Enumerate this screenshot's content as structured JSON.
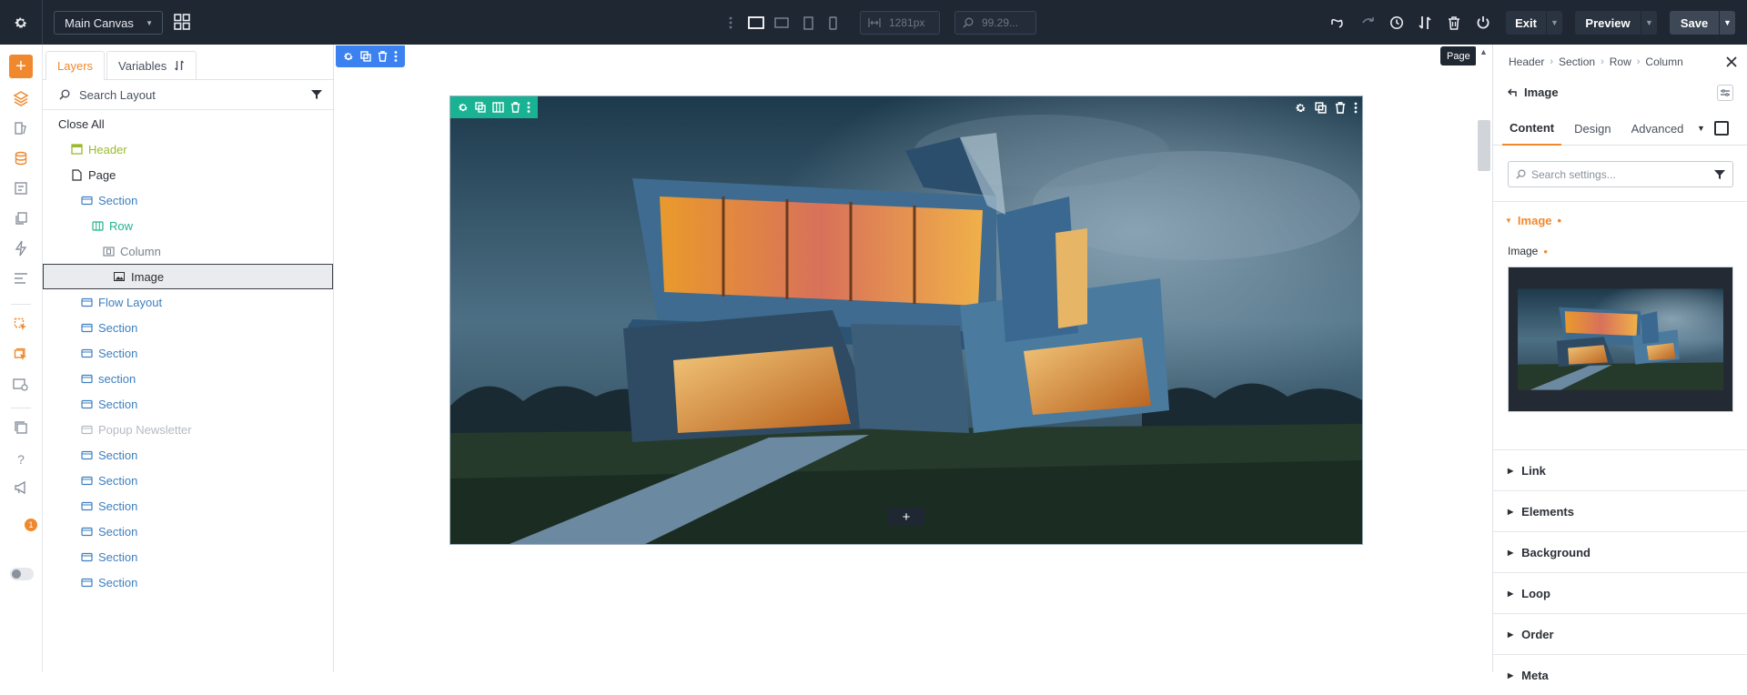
{
  "topbar": {
    "canvas_name": "Main Canvas",
    "width_value": "1281px",
    "zoom_value": "99.29...",
    "exit_label": "Exit",
    "preview_label": "Preview",
    "save_label": "Save"
  },
  "layers": {
    "tabs": [
      "Layers",
      "Variables"
    ],
    "search_placeholder": "Search Layout",
    "close_all": "Close All",
    "tree": [
      {
        "label": "Header",
        "icon": "header-icon",
        "color": "green"
      },
      {
        "label": "Page",
        "icon": "page-icon",
        "color": "dark"
      },
      {
        "label": "Section",
        "icon": "section-icon",
        "color": "blue"
      },
      {
        "label": "Row",
        "icon": "row-icon",
        "color": "teal"
      },
      {
        "label": "Column",
        "icon": "column-icon",
        "color": "gray"
      },
      {
        "label": "Image",
        "icon": "image-icon",
        "color": "dark",
        "selected": true
      },
      {
        "label": "Flow Layout",
        "icon": "section-icon",
        "color": "blue"
      },
      {
        "label": "Section",
        "icon": "section-icon",
        "color": "blue"
      },
      {
        "label": "Section",
        "icon": "section-icon",
        "color": "blue"
      },
      {
        "label": "section",
        "icon": "section-icon",
        "color": "blue"
      },
      {
        "label": "Section",
        "icon": "section-icon",
        "color": "blue"
      },
      {
        "label": "Popup Newsletter",
        "icon": "section-icon",
        "color": "faded"
      },
      {
        "label": "Section",
        "icon": "section-icon",
        "color": "blue"
      },
      {
        "label": "Section",
        "icon": "section-icon",
        "color": "blue"
      },
      {
        "label": "Section",
        "icon": "section-icon",
        "color": "blue"
      },
      {
        "label": "Section",
        "icon": "section-icon",
        "color": "blue"
      },
      {
        "label": "Section",
        "icon": "section-icon",
        "color": "blue"
      },
      {
        "label": "Section",
        "icon": "section-icon",
        "color": "blue"
      }
    ]
  },
  "rail": {
    "notification_count": "1"
  },
  "canvas": {
    "tooltip": "Page"
  },
  "settings": {
    "breadcrumb": [
      "Header",
      "Section",
      "Row",
      "Column"
    ],
    "element_title": "Image",
    "tabs": [
      "Content",
      "Design",
      "Advanced"
    ],
    "search_placeholder": "Search settings...",
    "group_title": "Image",
    "field_label": "Image",
    "groups": [
      "Link",
      "Elements",
      "Background",
      "Loop",
      "Order",
      "Meta"
    ]
  },
  "colors": {
    "accent": "#f0892d",
    "topbar_bg": "#1f2733",
    "section_blue": "#3e7fbf",
    "row_teal": "#1eb38f",
    "header_green": "#9bbb2a",
    "page_toolbar": "#3b82f0"
  }
}
